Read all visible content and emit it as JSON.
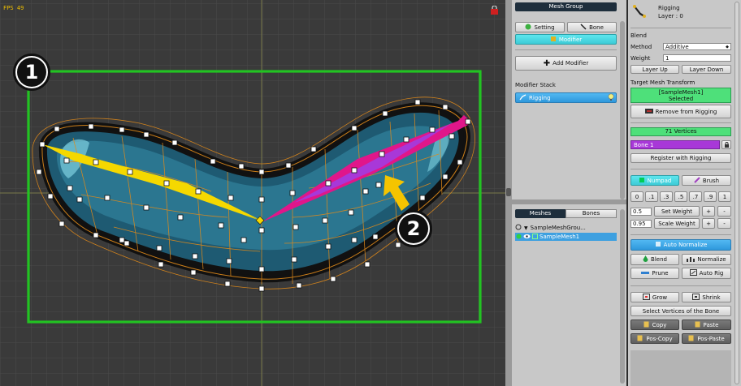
{
  "viewport": {
    "fps": "FPS 49"
  },
  "annotations": {
    "one": "1",
    "two": "2"
  },
  "mid_panel": {
    "mesh_group_header": "Mesh Group",
    "setting_label": "Setting",
    "bone_label": "Bone",
    "modifier_label": "Modifier",
    "add_modifier_label": "Add Modifier",
    "modifier_stack_label": "Modifier Stack",
    "stack_item": "Rigging",
    "tab_meshes": "Meshes",
    "tab_bones": "Bones",
    "tree_group": "SampleMeshGrou...",
    "tree_mesh": "SampleMesh1"
  },
  "right_panel": {
    "title": "Rigging",
    "layer": "Layer : 0",
    "blend_label": "Blend",
    "method_label": "Method",
    "method_value": "Additive",
    "weight_label": "Weight",
    "weight_value": "1",
    "layer_up": "Layer Up",
    "layer_down": "Layer Down",
    "target_label": "Target Mesh Transform",
    "target_name": "[SampleMesh1]",
    "target_selected": "Selected",
    "remove_label": "Remove from Rigging",
    "vertices": "71 Vertices",
    "bone_name": "Bone 1",
    "register_label": "Register with Rigging",
    "numpad_label": "Numpad",
    "brush_label": "Brush",
    "presets": [
      "0",
      ".1",
      ".3",
      ".5",
      ".7",
      ".9",
      "1"
    ],
    "set_weight_value": "0.5",
    "set_weight_label": "Set Weight",
    "scale_weight_value": "0.95",
    "scale_weight_label": "Scale Weight",
    "plus": "+",
    "minus": "-",
    "auto_normalize": "Auto Normalize",
    "blend_btn": "Blend",
    "normalize_btn": "Normalize",
    "prune_btn": "Prune",
    "auto_rig_btn": "Auto Rig",
    "grow_btn": "Grow",
    "shrink_btn": "Shrink",
    "select_bone_vertices": "Select Vertices of the Bone",
    "copy_btn": "Copy",
    "paste_btn": "Paste",
    "pos_copy_btn": "Pos-Copy",
    "pos_paste_btn": "Pos-Paste"
  },
  "colors": {
    "highlight_green": "#22c322",
    "bone_yellow": "#f5d800",
    "bone_magenta": "#e0168a",
    "bone_purple": "#a838d8",
    "mesh_teal": "#1e5a72",
    "accent_cyan": "#3ccbd6"
  }
}
